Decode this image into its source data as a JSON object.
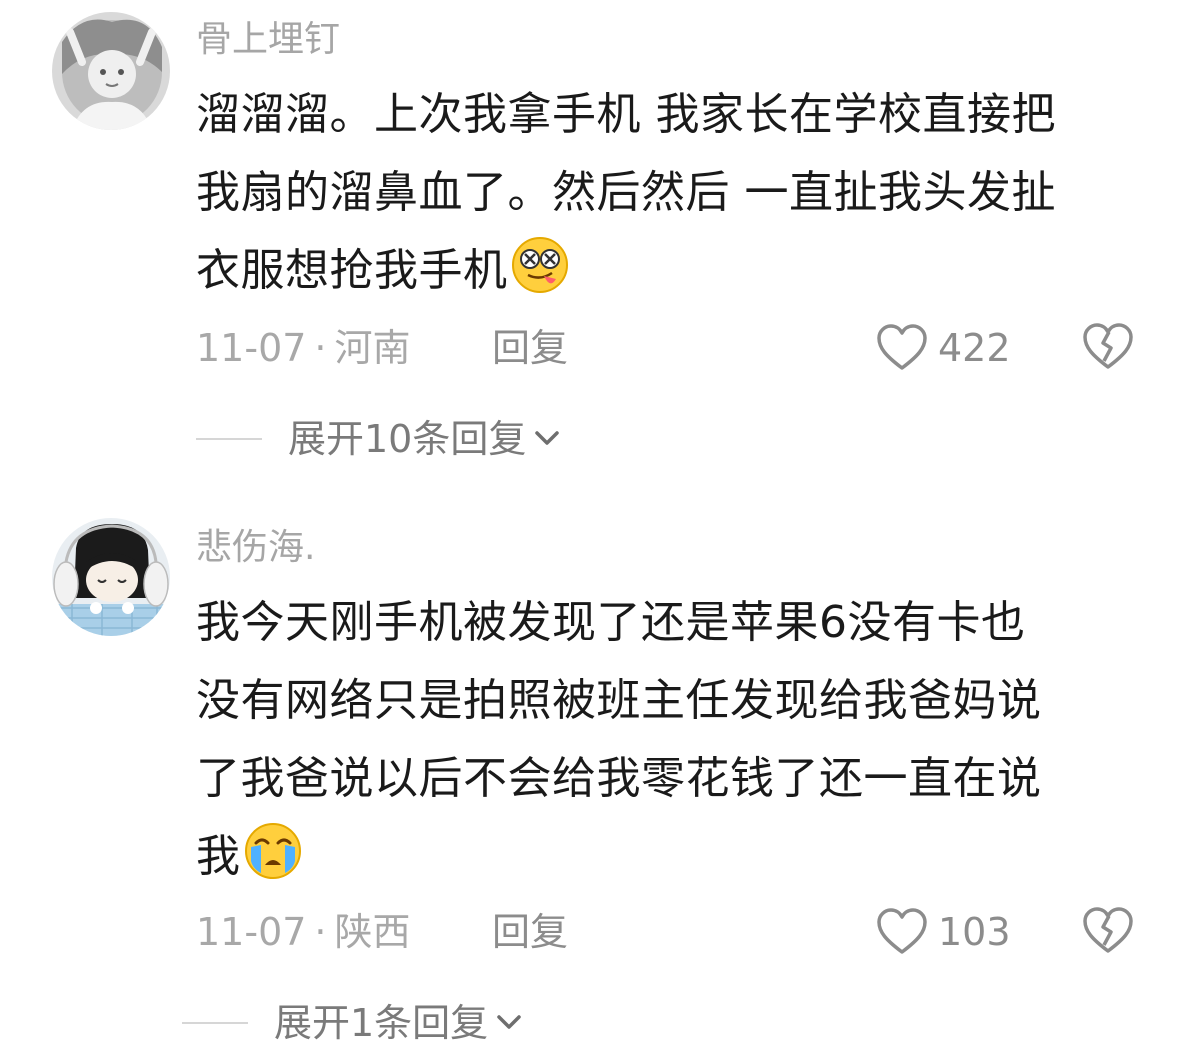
{
  "comments": [
    {
      "username": "骨上埋钉",
      "text_lines": [
        "溜溜溜。上次我拿手机 我家长在学校直接把",
        "我扇的溜鼻血了。然后然后 一直扯我头发扯",
        "衣服想抢我手机"
      ],
      "emoji": "dizzy-tongue-emoji",
      "date": "11-07",
      "separator": "·",
      "location": "河南",
      "reply_label": "回复",
      "likes": "422",
      "expand_label": "展开10条回复"
    },
    {
      "username": "悲伤海.",
      "text_lines": [
        "我今天刚手机被发现了还是苹果6没有卡也",
        "没有网络只是拍照被班主任发现给我爸妈说",
        "了我爸说以后不会给我零花钱了还一直在说",
        "我"
      ],
      "emoji": "crying-emoji",
      "date": "11-07",
      "separator": "·",
      "location": "陕西",
      "reply_label": "回复",
      "likes": "103",
      "expand_label": "展开1条回复"
    }
  ],
  "icons": {
    "like": "heart-outline-icon",
    "dislike": "broken-heart-icon",
    "expand": "chevron-down-icon"
  },
  "colors": {
    "username": "#a6a6a6",
    "text": "#1a1a1a",
    "meta": "#a8a8a8",
    "action": "#8c8c8c"
  }
}
